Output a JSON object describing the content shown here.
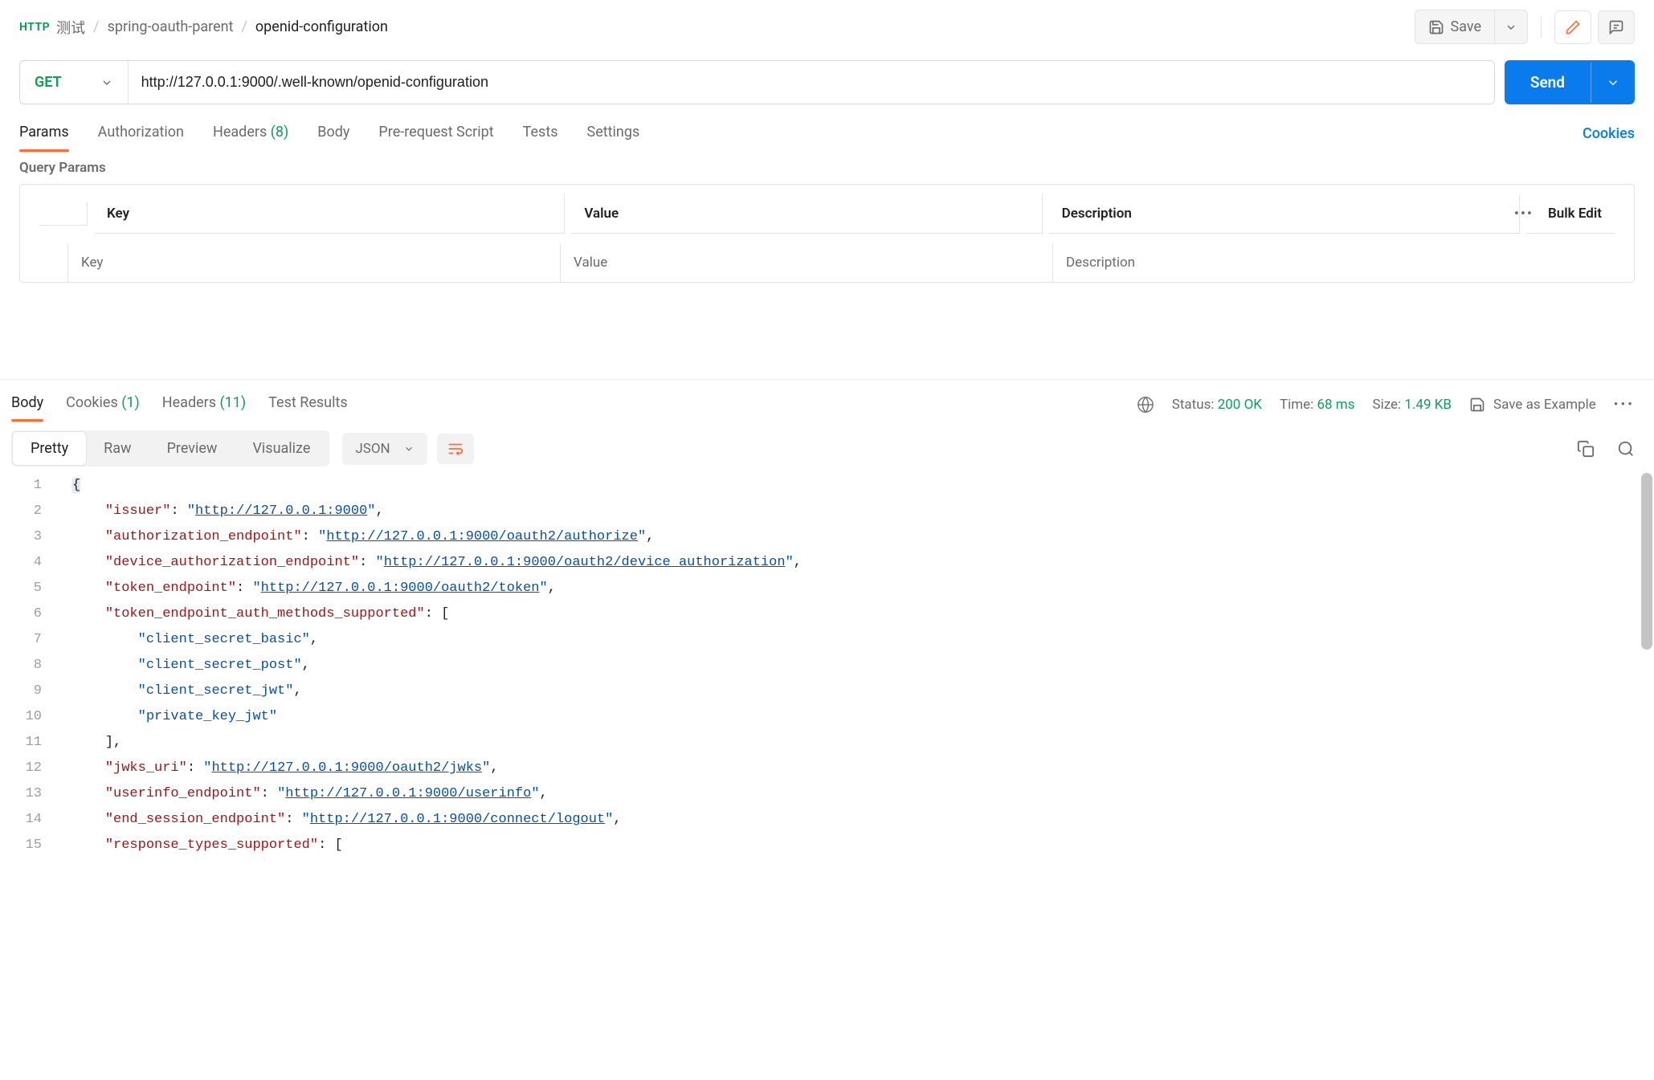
{
  "breadcrumb": {
    "root": "测试",
    "parent": "spring-oauth-parent",
    "current": "openid-configuration"
  },
  "toolbar": {
    "save": "Save"
  },
  "request": {
    "method": "GET",
    "url": "http://127.0.0.1:9000/.well-known/openid-configuration",
    "send": "Send"
  },
  "tabs": {
    "params": "Params",
    "authorization": "Authorization",
    "headers": "Headers",
    "headers_count": "(8)",
    "body": "Body",
    "prerequest": "Pre-request Script",
    "tests": "Tests",
    "settings": "Settings",
    "cookies": "Cookies"
  },
  "query": {
    "title": "Query Params",
    "key_h": "Key",
    "value_h": "Value",
    "desc_h": "Description",
    "bulk": "Bulk Edit",
    "key_p": "Key",
    "value_p": "Value",
    "desc_p": "Description"
  },
  "resp_tabs": {
    "body": "Body",
    "cookies": "Cookies",
    "cookies_count": "(1)",
    "headers": "Headers",
    "headers_count": "(11)",
    "tests": "Test Results"
  },
  "status": {
    "status_l": "Status:",
    "status_v": "200 OK",
    "time_l": "Time:",
    "time_v": "68 ms",
    "size_l": "Size:",
    "size_v": "1.49 KB",
    "save_example": "Save as Example"
  },
  "view": {
    "pretty": "Pretty",
    "raw": "Raw",
    "preview": "Preview",
    "visualize": "Visualize",
    "json": "JSON"
  },
  "json": {
    "lines": [
      "1",
      "2",
      "3",
      "4",
      "5",
      "6",
      "7",
      "8",
      "9",
      "10",
      "11",
      "12",
      "13",
      "14",
      "15"
    ],
    "l2k": "\"issuer\"",
    "l2v": "http://127.0.0.1:9000",
    "l3k": "\"authorization_endpoint\"",
    "l3v": "http://127.0.0.1:9000/oauth2/authorize",
    "l4k": "\"device_authorization_endpoint\"",
    "l4v": "http://127.0.0.1:9000/oauth2/device_authorization",
    "l5k": "\"token_endpoint\"",
    "l5v": "http://127.0.0.1:9000/oauth2/token",
    "l6k": "\"token_endpoint_auth_methods_supported\"",
    "l7": "\"client_secret_basic\"",
    "l8": "\"client_secret_post\"",
    "l9": "\"client_secret_jwt\"",
    "l10": "\"private_key_jwt\"",
    "l12k": "\"jwks_uri\"",
    "l12v": "http://127.0.0.1:9000/oauth2/jwks",
    "l13k": "\"userinfo_endpoint\"",
    "l13v": "http://127.0.0.1:9000/userinfo",
    "l14k": "\"end_session_endpoint\"",
    "l14v": "http://127.0.0.1:9000/connect/logout",
    "l15k": "\"response_types_supported\""
  }
}
